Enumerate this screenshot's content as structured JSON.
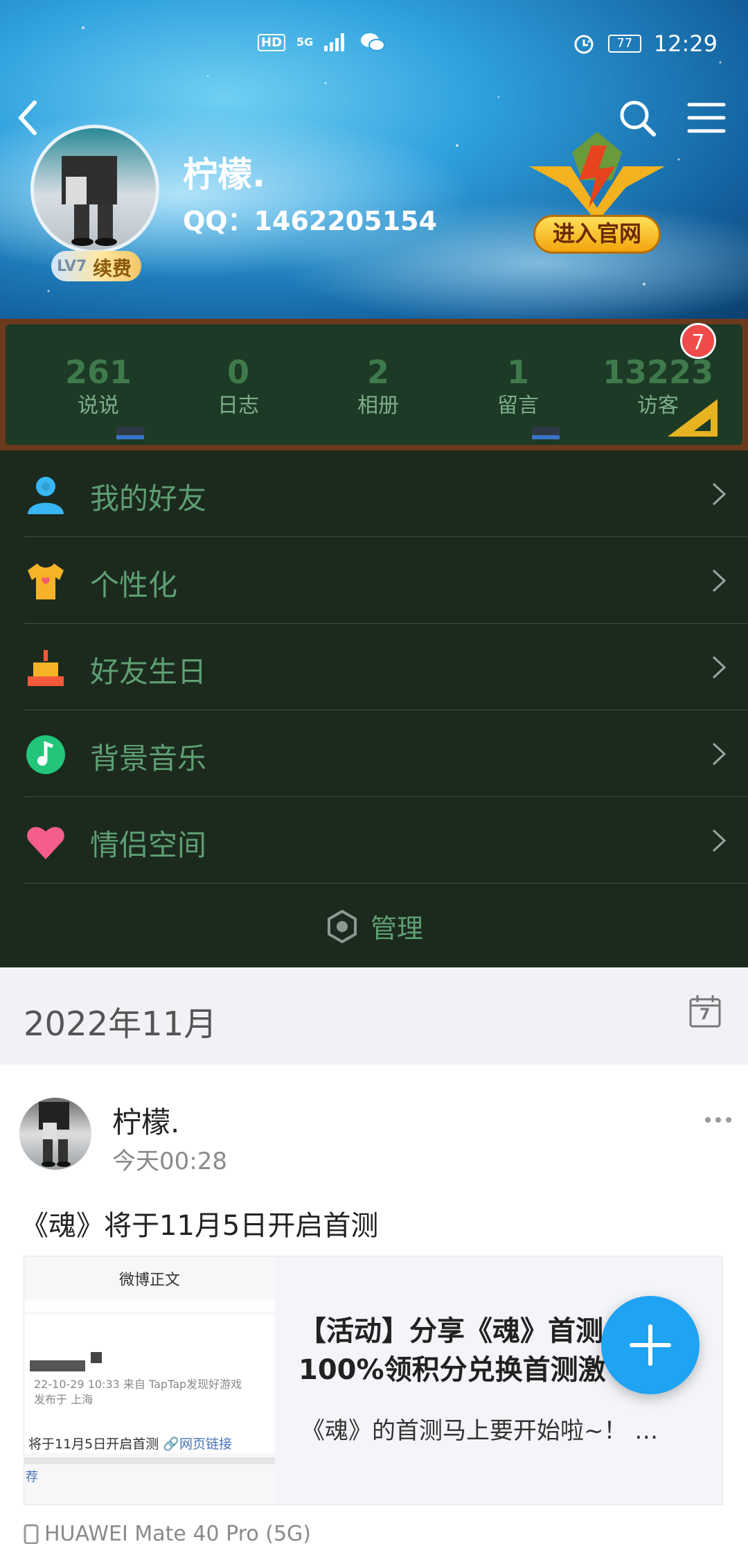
{
  "status_bar": {
    "hd": "HD",
    "network": "5G",
    "battery": "77",
    "time": "12:29"
  },
  "profile": {
    "nickname": "柠檬.",
    "qq": "QQ：1462205154",
    "level": "LV7",
    "renew": "续费",
    "official_site": "进入官网"
  },
  "stats": [
    {
      "value": "261",
      "label": "说说"
    },
    {
      "value": "0",
      "label": "日志"
    },
    {
      "value": "2",
      "label": "相册"
    },
    {
      "value": "1",
      "label": "留言"
    },
    {
      "value": "13223",
      "label": "访客"
    }
  ],
  "visitor_badge": "7",
  "menu": [
    {
      "label": "我的好友",
      "icon": "friend-icon"
    },
    {
      "label": "个性化",
      "icon": "tshirt-icon"
    },
    {
      "label": "好友生日",
      "icon": "cake-icon"
    },
    {
      "label": "背景音乐",
      "icon": "music-icon"
    },
    {
      "label": "情侣空间",
      "icon": "heart-icon"
    }
  ],
  "manage_label": "管理",
  "month": {
    "label": "2022年11月",
    "calendar_day": "7"
  },
  "post": {
    "author": "柠檬.",
    "time": "今天00:28",
    "text": "《魂》将于11月5日开启首测",
    "thumb_title": "微博正文",
    "thumb_meta_1": "22-10-29 10:33  来自 TapTap发现好游戏",
    "thumb_meta_2": "发布于 上海",
    "thumb_line": "将于11月5日开启首测",
    "thumb_link": "🔗网页链接",
    "thumb_rec": "荐",
    "share_title_1": "【活动】分享《魂》首测",
    "share_title_2": "100%领积分兑换首测激",
    "share_desc": "《魂》的首测马上要开始啦~！ …",
    "device": "HUAWEI Mate 40 Pro (5G)"
  },
  "colors": {
    "accent": "#1fa3f3",
    "menu_bg": "#1c2a1e",
    "menu_text": "#5e9f72",
    "badge_red": "#f04b4b"
  }
}
